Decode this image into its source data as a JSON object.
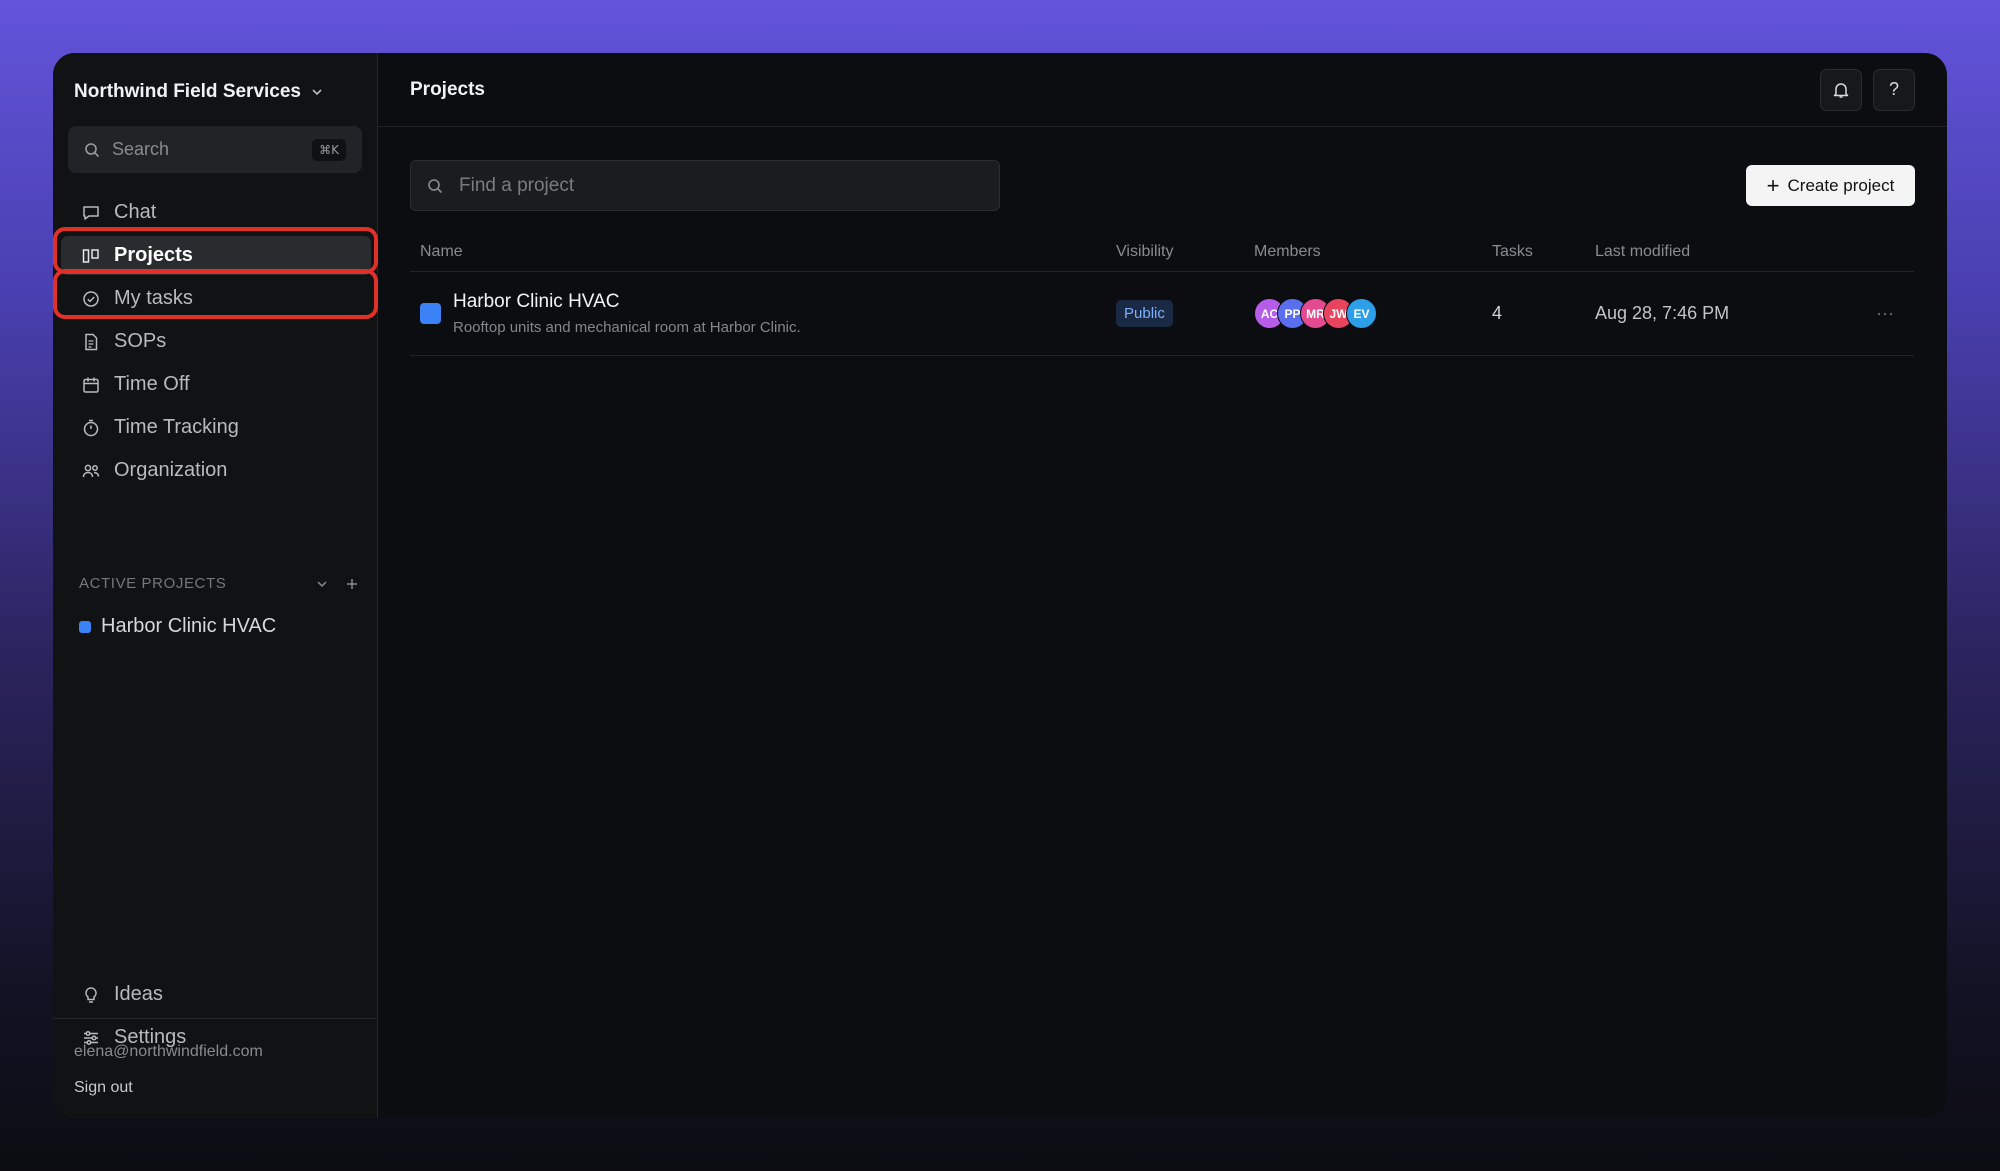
{
  "sidebar": {
    "org_name": "Northwind Field Services",
    "search": {
      "label": "Search",
      "shortcut": "⌘K"
    },
    "nav": [
      {
        "label": "Chat",
        "icon": "chat-icon"
      },
      {
        "label": "Projects",
        "icon": "board-icon",
        "active": true
      },
      {
        "label": "My tasks",
        "icon": "check-circle-icon"
      },
      {
        "label": "SOPs",
        "icon": "document-icon"
      },
      {
        "label": "Time Off",
        "icon": "calendar-icon"
      },
      {
        "label": "Time Tracking",
        "icon": "stopwatch-icon"
      },
      {
        "label": "Organization",
        "icon": "people-icon"
      }
    ],
    "active_projects": {
      "title": "ACTIVE PROJECTS",
      "items": [
        {
          "label": "Harbor Clinic HVAC",
          "color": "#3b82f6"
        }
      ]
    },
    "bottom_nav": [
      {
        "label": "Ideas",
        "icon": "lightbulb-icon"
      },
      {
        "label": "Settings",
        "icon": "sliders-icon"
      }
    ],
    "user_email": "elena@northwindfield.com",
    "sign_out": "Sign out"
  },
  "header": {
    "title": "Projects",
    "help_label": "?"
  },
  "toolbar": {
    "find_placeholder": "Find a project",
    "create_label": "Create project"
  },
  "table": {
    "columns": [
      "Name",
      "Visibility",
      "Members",
      "Tasks",
      "Last modified"
    ],
    "rows": [
      {
        "name": "Harbor Clinic HVAC",
        "description": "Rooftop units and mechanical room at Harbor Clinic.",
        "color": "#3b82f6",
        "visibility": "Public",
        "members": [
          {
            "initials": "AC",
            "color": "#b55ce8"
          },
          {
            "initials": "PP",
            "color": "#5a6ef0"
          },
          {
            "initials": "MR",
            "color": "#e34a8f"
          },
          {
            "initials": "JW",
            "color": "#e8445e"
          },
          {
            "initials": "EV",
            "color": "#2d9ee8"
          }
        ],
        "tasks": "4",
        "last_modified": "Aug 28, 7:46 PM",
        "actions": "···"
      }
    ]
  },
  "highlight_color": "#e0302a"
}
